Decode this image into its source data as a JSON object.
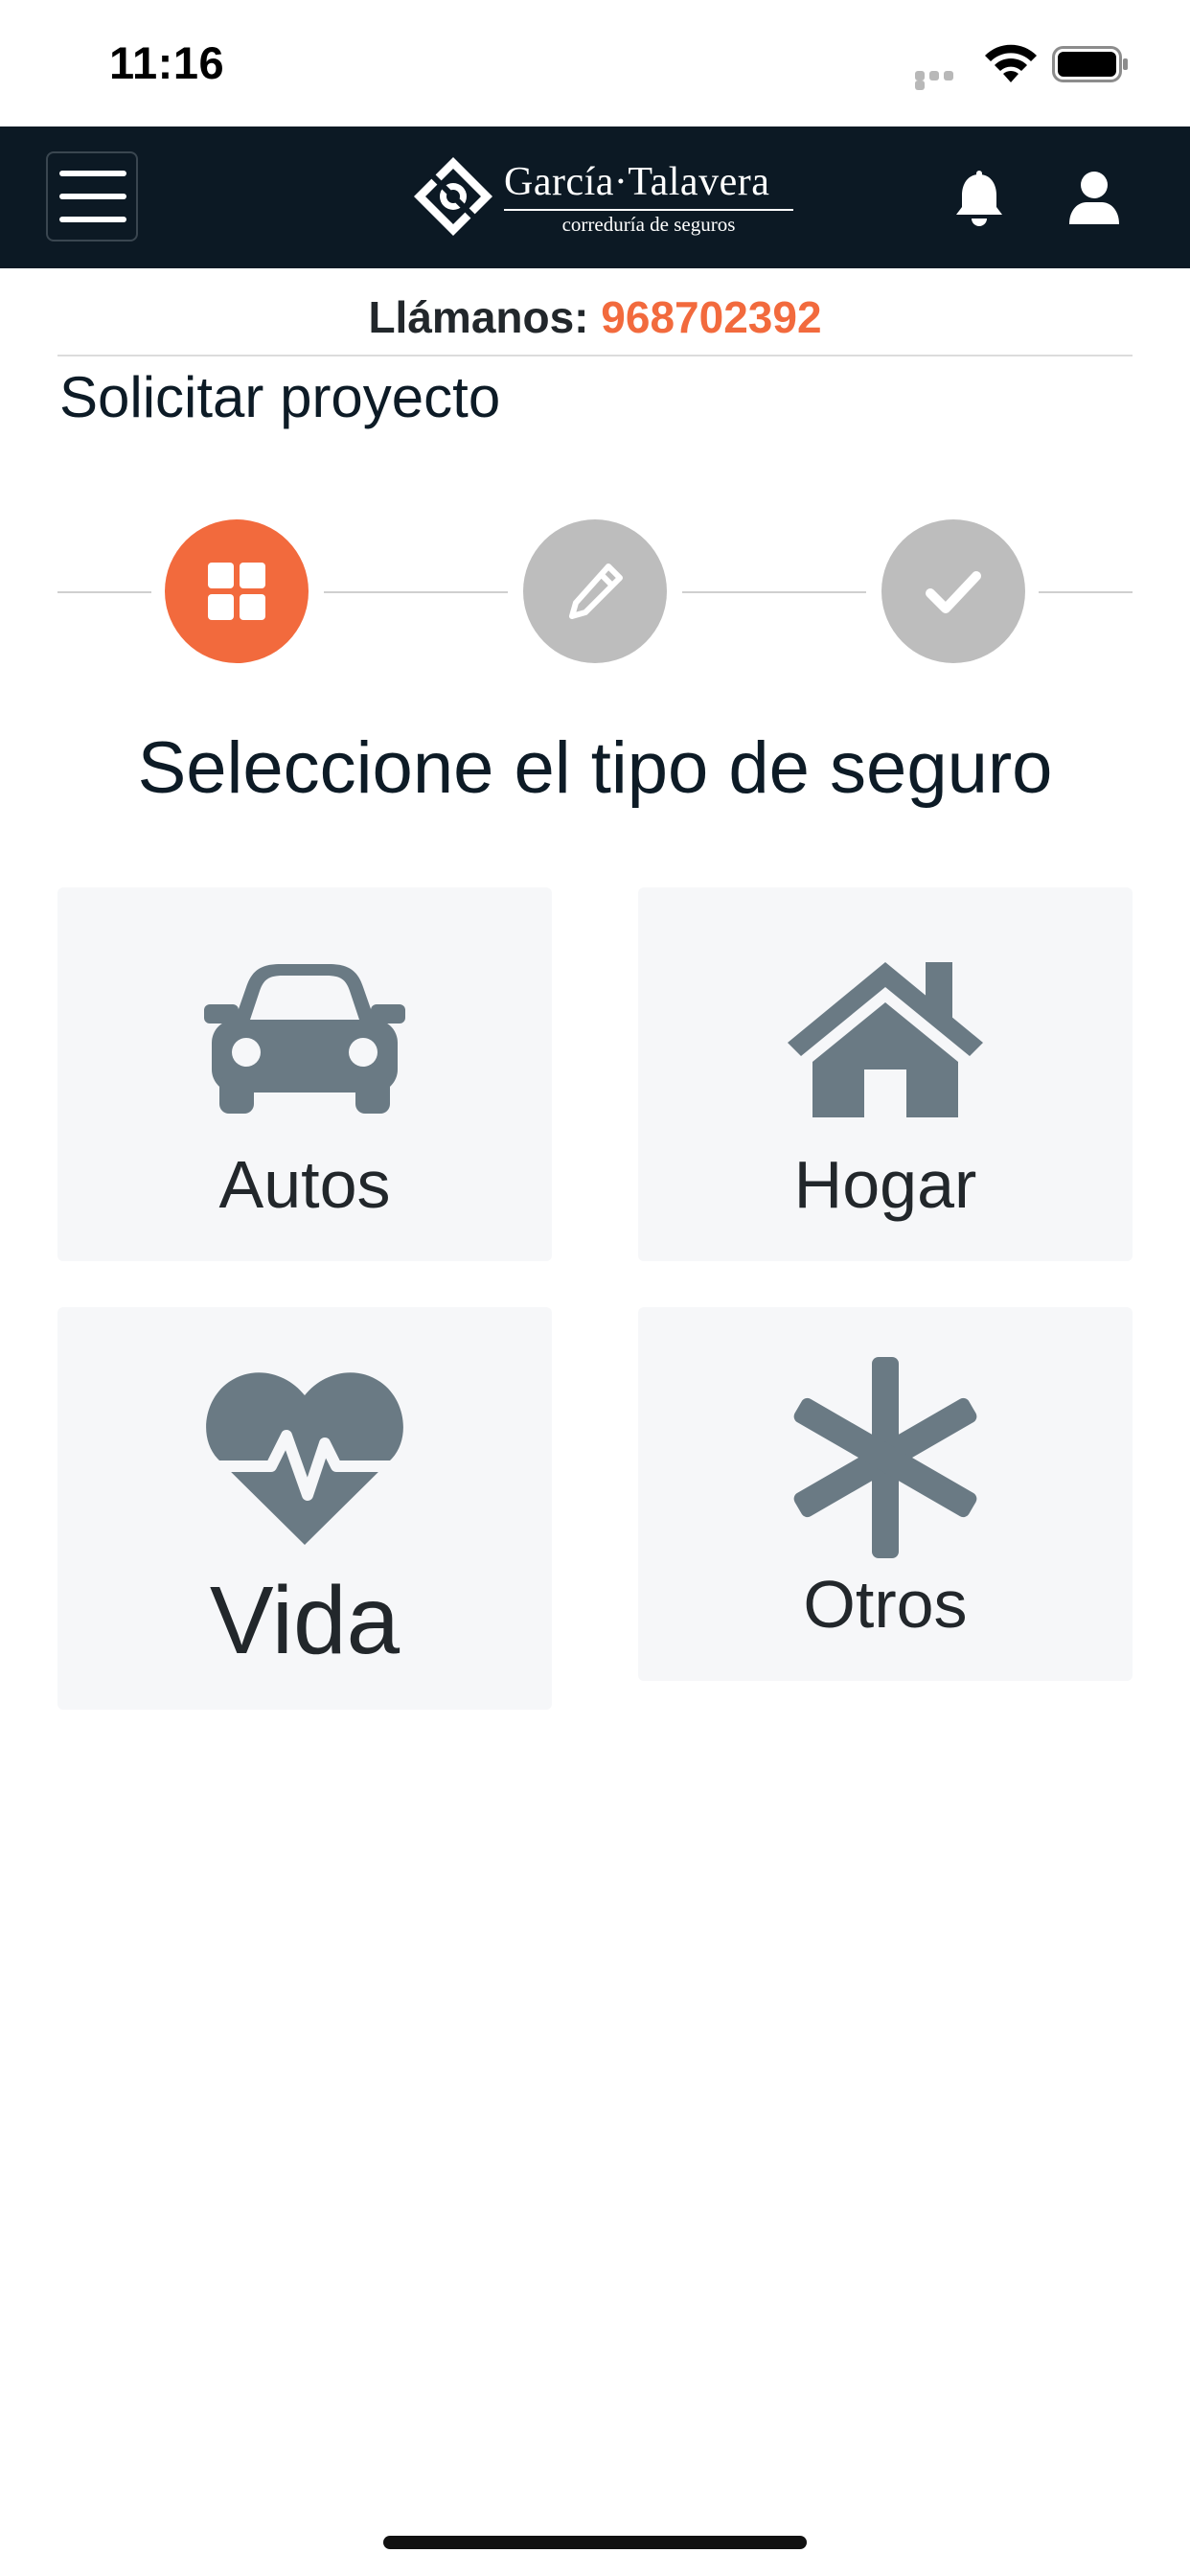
{
  "status_bar": {
    "time": "11:16"
  },
  "navbar": {
    "logo_name": "García·Talavera",
    "logo_tagline": "correduría de seguros",
    "icons": [
      "menu-icon",
      "logo-mark",
      "bell-icon",
      "user-icon"
    ]
  },
  "contact": {
    "label": "Llámanos: ",
    "phone": "968702392"
  },
  "page": {
    "title": "Solicitar proyecto",
    "heading": "Seleccione el tipo de seguro"
  },
  "stepper": {
    "steps": [
      {
        "icon": "grid-icon",
        "state": "active"
      },
      {
        "icon": "pencil-icon",
        "state": "inactive"
      },
      {
        "icon": "check-icon",
        "state": "inactive"
      }
    ]
  },
  "insurance_types": [
    {
      "label": "Autos",
      "icon": "car-icon"
    },
    {
      "label": "Hogar",
      "icon": "house-icon"
    },
    {
      "label": "Vida",
      "icon": "heartbeat-icon"
    },
    {
      "label": "Otros",
      "icon": "asterisk-icon"
    }
  ],
  "colors": {
    "accent": "#f26a3d",
    "navbar": "#0c1924",
    "icon_gray": "#6a7a84",
    "step_inactive": "#bdbdbd",
    "card_bg": "#f6f7f9"
  }
}
